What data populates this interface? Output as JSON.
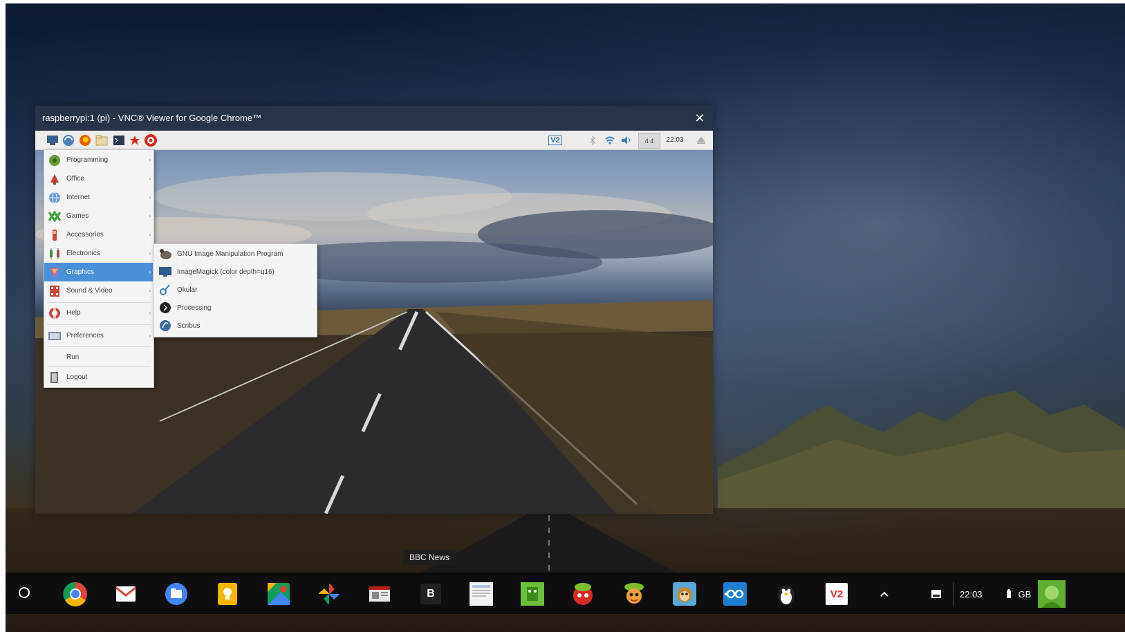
{
  "window": {
    "title": "raspberrypi:1 (pi) - VNC® Viewer for Google Chrome™",
    "close_glyph": "✕"
  },
  "panel": {
    "launchers": [
      "menu-icon",
      "web-browser-icon",
      "firefox-icon",
      "file-manager-icon",
      "terminal-icon",
      "wolfram-icon",
      "mathematica-icon"
    ],
    "tray": {
      "vnc_badge": "V2",
      "clock": "22:03",
      "cpu_text": "4 4"
    }
  },
  "menu": {
    "items": [
      {
        "label": "Programming",
        "icon": "programming-icon",
        "has_submenu": true
      },
      {
        "label": "Office",
        "icon": "office-icon",
        "has_submenu": true
      },
      {
        "label": "Internet",
        "icon": "internet-icon",
        "has_submenu": true
      },
      {
        "label": "Games",
        "icon": "games-icon",
        "has_submenu": true
      },
      {
        "label": "Accessories",
        "icon": "accessories-icon",
        "has_submenu": true
      },
      {
        "label": "Electronics",
        "icon": "electronics-icon",
        "has_submenu": true
      },
      {
        "label": "Graphics",
        "icon": "graphics-icon",
        "has_submenu": true,
        "active": true
      },
      {
        "label": "Sound & Video",
        "icon": "sound-video-icon",
        "has_submenu": true
      },
      {
        "label": "Help",
        "icon": "help-icon",
        "has_submenu": true
      },
      {
        "label": "Preferences",
        "icon": "preferences-icon",
        "has_submenu": true
      },
      {
        "label": "Run",
        "icon": "",
        "has_submenu": false
      },
      {
        "label": "Logout",
        "icon": "logout-icon",
        "has_submenu": false
      }
    ],
    "arrow_glyph": "›"
  },
  "submenu": {
    "items": [
      {
        "label": "GNU Image Manipulation Program",
        "icon": "gimp-icon"
      },
      {
        "label": "ImageMagick (color depth=q16)",
        "icon": "imagemagick-icon"
      },
      {
        "label": "Okular",
        "icon": "okular-icon"
      },
      {
        "label": "Processing",
        "icon": "processing-icon"
      },
      {
        "label": "Scribus",
        "icon": "scribus-icon"
      }
    ]
  },
  "tooltip": {
    "text": "BBC News"
  },
  "shelf": {
    "apps": [
      {
        "name": "chrome-icon"
      },
      {
        "name": "gmail-icon"
      },
      {
        "name": "files-icon"
      },
      {
        "name": "keep-icon"
      },
      {
        "name": "maps-icon"
      },
      {
        "name": "photos-icon"
      },
      {
        "name": "bbc-news-icon"
      },
      {
        "name": "b-app-icon",
        "glyph": "B"
      },
      {
        "name": "document-app-icon"
      },
      {
        "name": "game-green-icon"
      },
      {
        "name": "game-red-icon"
      },
      {
        "name": "game-character-icon"
      },
      {
        "name": "monkey-game-icon"
      },
      {
        "name": "infinity-app-icon"
      },
      {
        "name": "penguin-app-icon"
      },
      {
        "name": "vnc-viewer-icon",
        "glyph": "V2"
      }
    ],
    "status": {
      "time": "22:03",
      "locale": "GB"
    }
  },
  "colors": {
    "menu_highlight": "#4a90d9",
    "shelf_bg": "#0a0a0e",
    "panel_bg": "#edeceb"
  }
}
